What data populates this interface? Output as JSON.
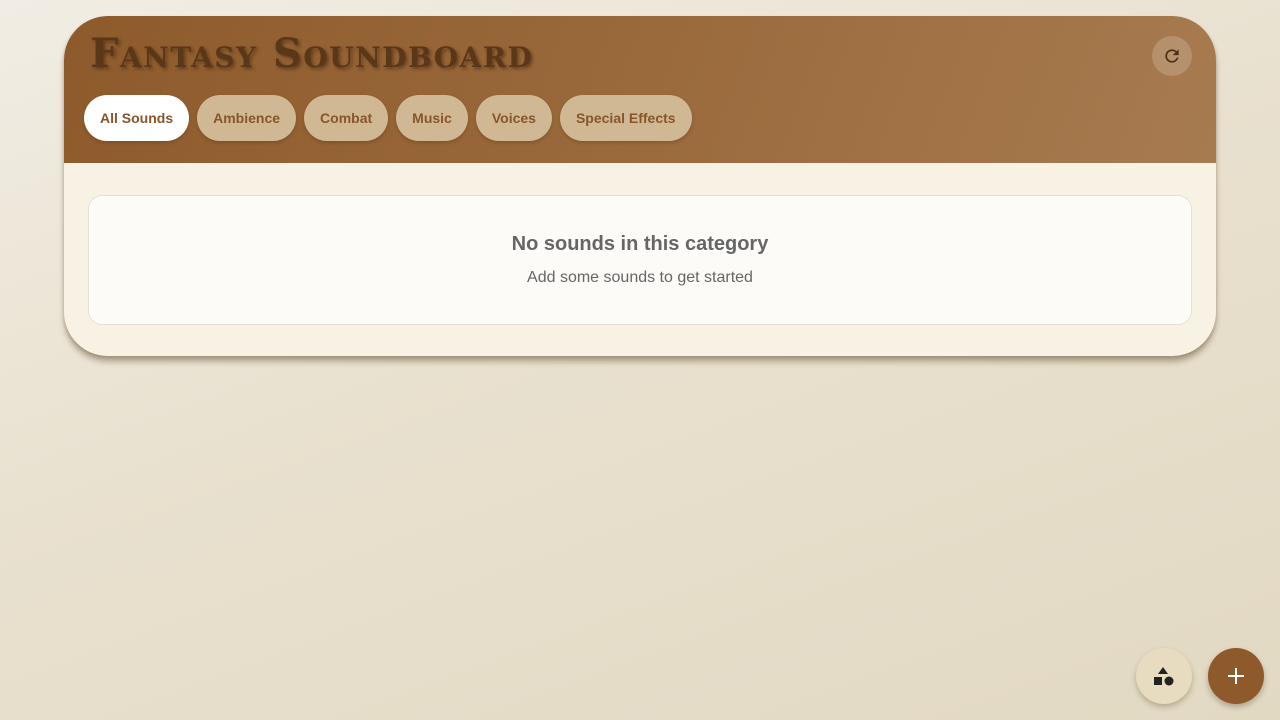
{
  "app": {
    "title": "Fantasy Soundboard"
  },
  "header": {
    "refresh_icon": "refresh-icon"
  },
  "tabs": [
    {
      "label": "All Sounds",
      "active": true
    },
    {
      "label": "Ambience",
      "active": false
    },
    {
      "label": "Combat",
      "active": false
    },
    {
      "label": "Music",
      "active": false
    },
    {
      "label": "Voices",
      "active": false
    },
    {
      "label": "Special Effects",
      "active": false
    }
  ],
  "empty_state": {
    "title": "No sounds in this category",
    "subtitle": "Add some sounds to get started"
  },
  "fabs": {
    "shapes_icon": "shapes-icon",
    "add_icon": "plus-icon"
  },
  "colors": {
    "brand_brown": "#8e5a2b",
    "title_text": "#5a3718",
    "tab_background": "#d0b894",
    "tab_active_background": "#ffffff",
    "panel_background": "#f7f2e3"
  }
}
